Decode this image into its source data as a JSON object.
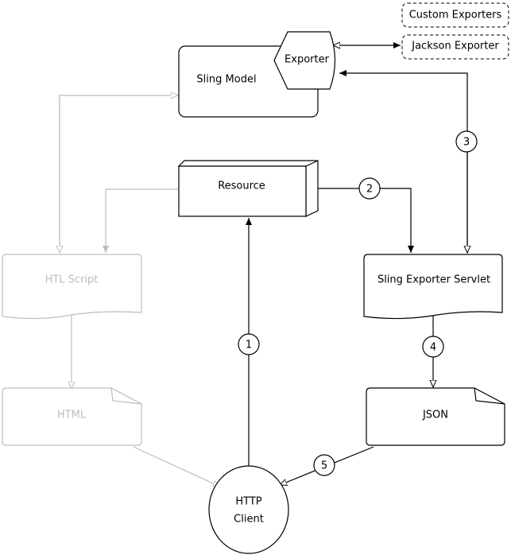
{
  "nodes": {
    "sling_model": "Sling Model",
    "exporter": "Exporter",
    "custom_exporters": "Custom Exporters",
    "jackson_exporter": "Jackson Exporter",
    "resource": "Resource",
    "htl_script": "HTL Script",
    "html": "HTML",
    "sling_exporter_servlet": "Sling Exporter Servlet",
    "json": "JSON",
    "http_client_line1": "HTTP",
    "http_client_line2": "Client"
  },
  "steps": [
    "1",
    "2",
    "3",
    "4",
    "5"
  ],
  "colors": {
    "active": "#000000",
    "inactive": "#bdbdbd"
  }
}
